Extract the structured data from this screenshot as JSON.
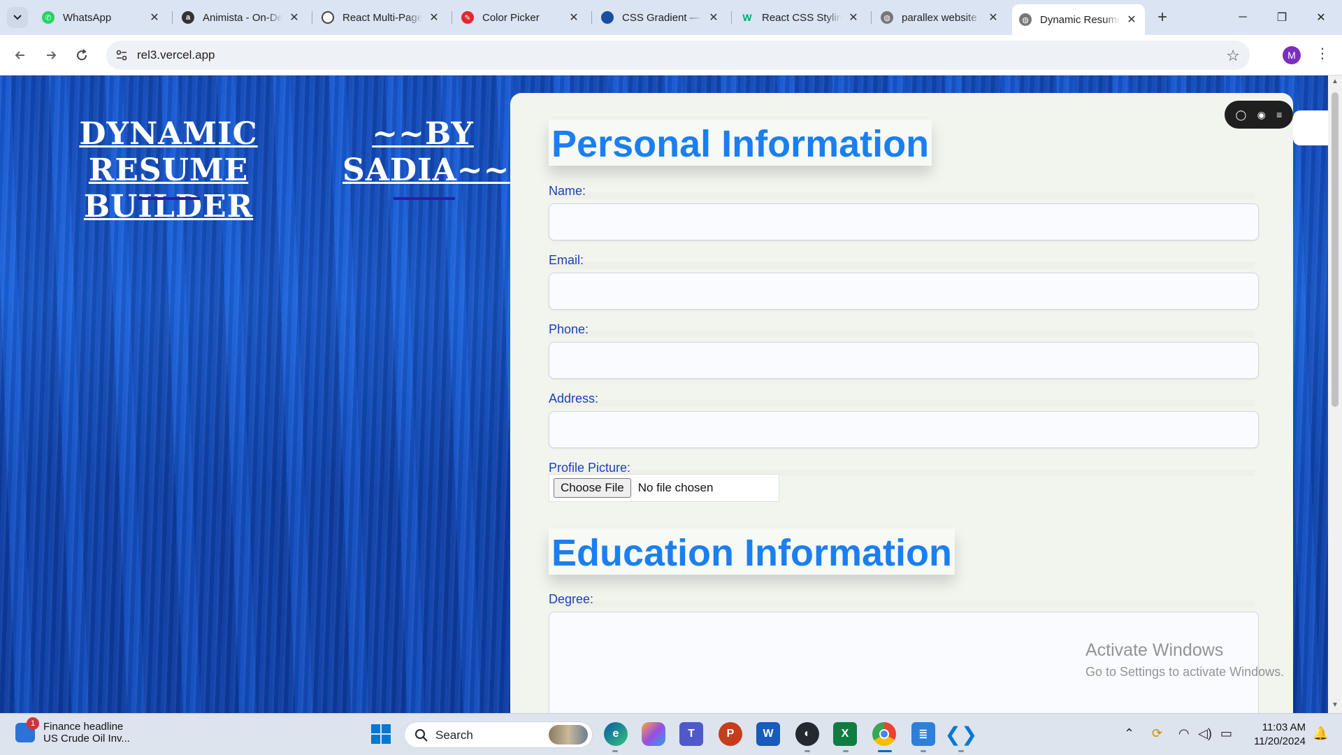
{
  "browser": {
    "tabs": [
      {
        "title": "WhatsApp",
        "icon": "whatsapp-icon",
        "color": "#25d366"
      },
      {
        "title": "Animista - On-Demand",
        "icon": "animista-icon",
        "color": "#333333"
      },
      {
        "title": "React Multi-Page",
        "icon": "chatgpt-icon",
        "color": "#444444"
      },
      {
        "title": "Color Picker",
        "icon": "color-picker-icon",
        "color": "#e0282e"
      },
      {
        "title": "CSS Gradient —",
        "icon": "css-gradient-icon",
        "color": "#1a4fa0"
      },
      {
        "title": "React CSS Styling",
        "icon": "w3-icon",
        "color": "#04aa6d"
      },
      {
        "title": "parallex website",
        "icon": "globe-icon",
        "color": "#666666"
      },
      {
        "title": "Dynamic Resume",
        "icon": "globe-icon",
        "color": "#666666",
        "active": true
      }
    ],
    "url": "rel3.vercel.app",
    "profile_initial": "M",
    "accent": "#0067c0"
  },
  "page": {
    "title": "DYNAMIC RESUME BUILDER",
    "byline": "~~BY SADIA~~",
    "sections": {
      "personal": {
        "heading": "Personal Information",
        "name_label": "Name:",
        "email_label": "Email:",
        "phone_label": "Phone:",
        "address_label": "Address:",
        "picture_label": "Profile Picture:",
        "file_button": "Choose File",
        "file_status": "No file chosen"
      },
      "education": {
        "heading": "Education Information",
        "degree_label": "Degree:"
      }
    },
    "colors": {
      "heading": "#1a7ff0",
      "label": "#1a3fb8",
      "background": "#1452c9"
    }
  },
  "watermark": {
    "title": "Activate Windows",
    "subtitle": "Go to Settings to activate Windows."
  },
  "taskbar": {
    "news_badge": "1",
    "news_title": "Finance headline",
    "news_text": "US Crude Oil Inv...",
    "search_label": "Search",
    "time": "11:03 AM",
    "date": "11/20/2024"
  }
}
